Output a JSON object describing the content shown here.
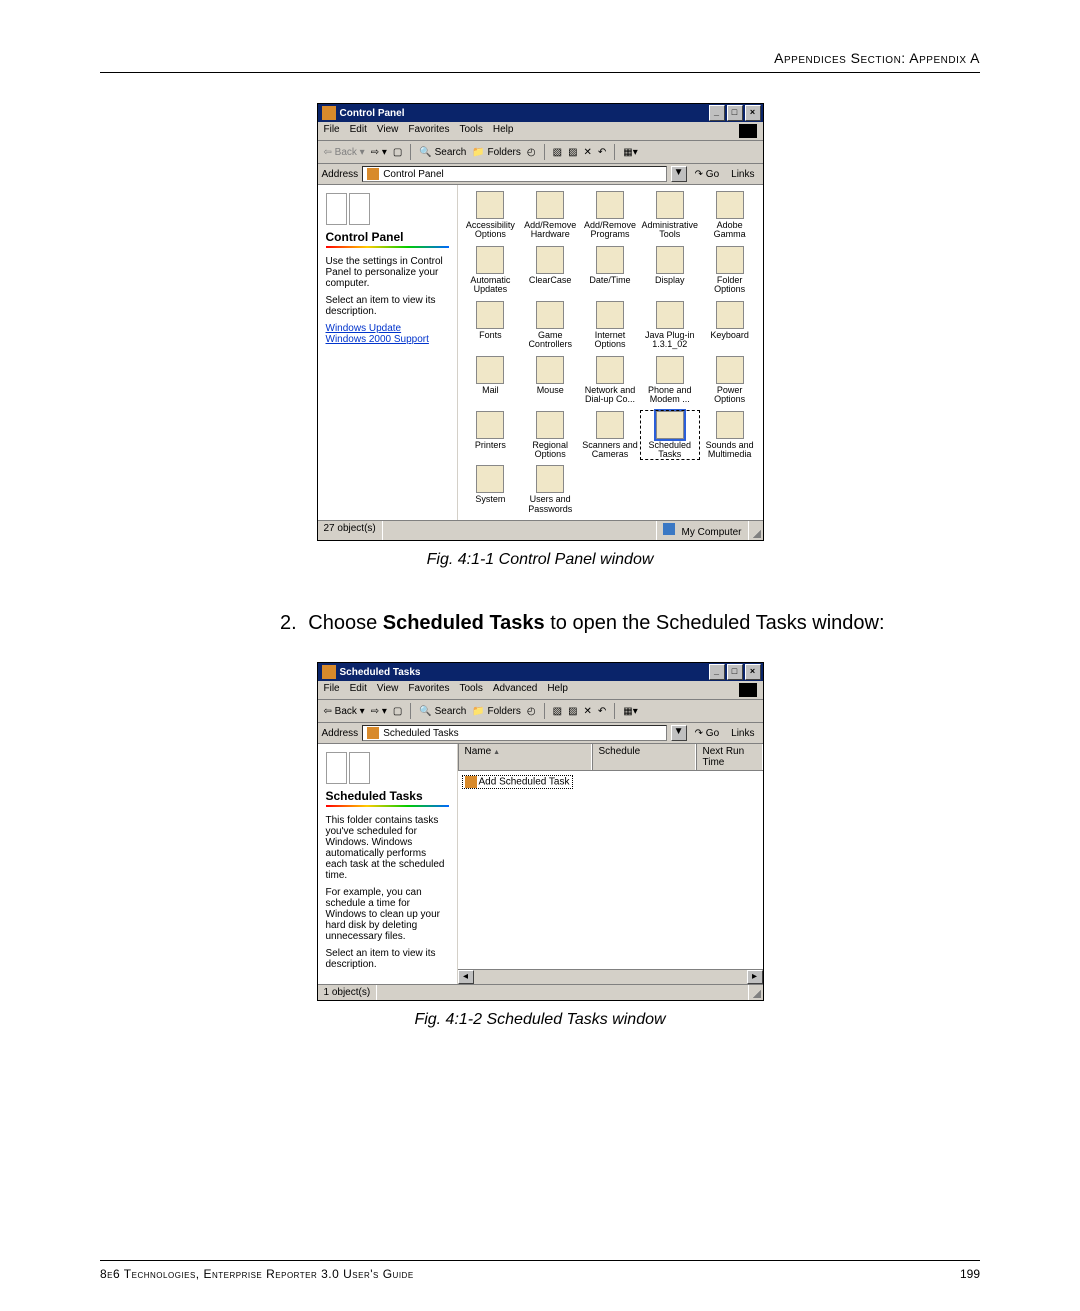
{
  "page_header": "Appendices Section: Appendix A",
  "fig1_caption": "Fig. 4:1-1  Control Panel window",
  "fig2_caption": "Fig. 4:1-2  Scheduled Tasks window",
  "step2_num": "2.",
  "step2_pre": "Choose ",
  "step2_bold": "Scheduled Tasks",
  "step2_post": " to open the Scheduled Tasks window:",
  "cp": {
    "title": "Control Panel",
    "menus": [
      "File",
      "Edit",
      "View",
      "Favorites",
      "Tools",
      "Help"
    ],
    "toolbar": {
      "back": "Back",
      "search": "Search",
      "folders": "Folders"
    },
    "addr_label": "Address",
    "addr_value": "Control Panel",
    "go": "Go",
    "links": "Links",
    "side_title": "Control Panel",
    "side_p1": "Use the settings in Control Panel to personalize your computer.",
    "side_p2": "Select an item to view its description.",
    "side_links": [
      "Windows Update",
      "Windows 2000 Support"
    ],
    "items": [
      "Accessibility Options",
      "Add/Remove Hardware",
      "Add/Remove Programs",
      "Administrative Tools",
      "Adobe Gamma",
      "Automatic Updates",
      "ClearCase",
      "Date/Time",
      "Display",
      "Folder Options",
      "Fonts",
      "Game Controllers",
      "Internet Options",
      "Java Plug-in 1.3.1_02",
      "Keyboard",
      "Mail",
      "Mouse",
      "Network and Dial-up Co...",
      "Phone and Modem ...",
      "Power Options",
      "Printers",
      "Regional Options",
      "Scanners and Cameras",
      "Scheduled Tasks",
      "Sounds and Multimedia",
      "System",
      "Users and Passwords"
    ],
    "selected_index": 23,
    "status_left": "27 object(s)",
    "status_right": "My Computer"
  },
  "st": {
    "title": "Scheduled Tasks",
    "menus": [
      "File",
      "Edit",
      "View",
      "Favorites",
      "Tools",
      "Advanced",
      "Help"
    ],
    "toolbar": {
      "back": "Back",
      "search": "Search",
      "folders": "Folders"
    },
    "addr_label": "Address",
    "addr_value": "Scheduled Tasks",
    "go": "Go",
    "links": "Links",
    "side_title": "Scheduled Tasks",
    "side_p1": "This folder contains tasks you've scheduled for Windows. Windows automatically performs each task at the scheduled time.",
    "side_p2": "For example, you can schedule a time for Windows to clean up your hard disk by deleting unnecessary files.",
    "side_p3": "Select an item to view its description.",
    "cols": [
      "Name",
      "Schedule",
      "Next Run Time"
    ],
    "row1": "Add Scheduled Task",
    "status_left": "1 object(s)"
  },
  "footer_left": "8e6 Technologies, Enterprise Reporter 3.0 User's Guide",
  "footer_right": "199"
}
